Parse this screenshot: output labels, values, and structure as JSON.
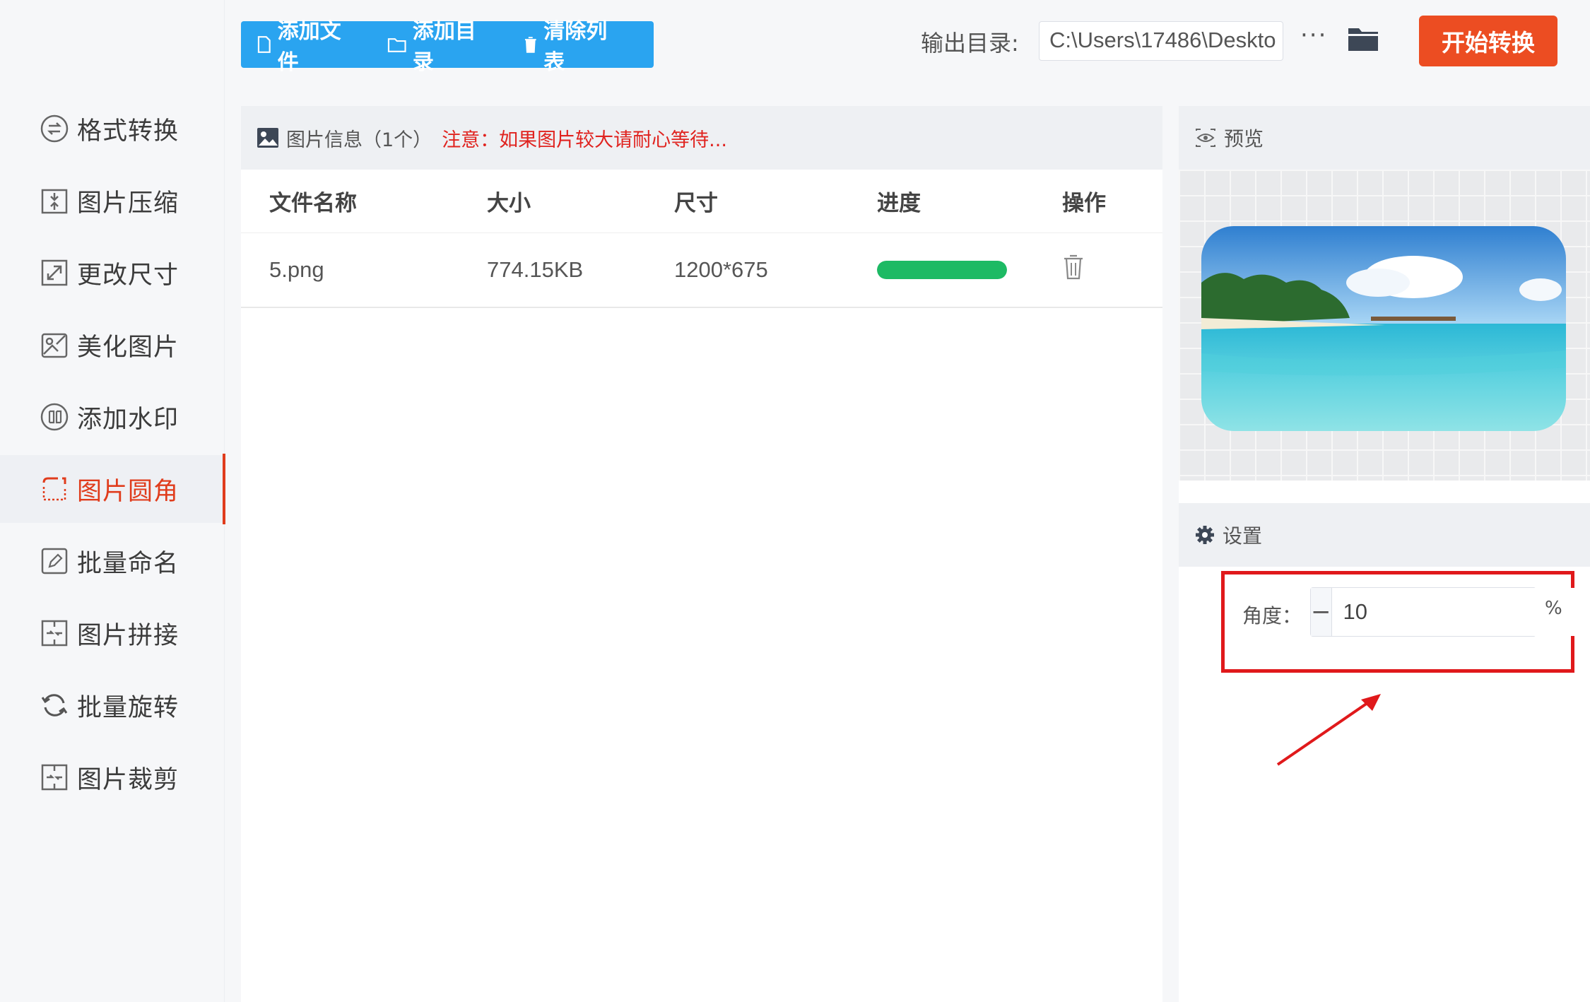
{
  "sidebar": {
    "items": [
      {
        "label": "格式转换",
        "icon": "format-convert-icon"
      },
      {
        "label": "图片压缩",
        "icon": "compress-icon"
      },
      {
        "label": "更改尺寸",
        "icon": "resize-icon"
      },
      {
        "label": "美化图片",
        "icon": "beautify-icon"
      },
      {
        "label": "添加水印",
        "icon": "watermark-icon"
      },
      {
        "label": "图片圆角",
        "icon": "rounded-corner-icon",
        "active": true
      },
      {
        "label": "批量命名",
        "icon": "rename-icon"
      },
      {
        "label": "图片拼接",
        "icon": "stitch-icon"
      },
      {
        "label": "批量旋转",
        "icon": "rotate-icon"
      },
      {
        "label": "图片裁剪",
        "icon": "crop-icon"
      }
    ]
  },
  "toolbar": {
    "add_file": "添加文件",
    "add_dir": "添加目录",
    "clear_list": "清除列表",
    "output_label": "输出目录:",
    "output_path": "C:\\Users\\17486\\Deskto",
    "more": "···",
    "start": "开始转换"
  },
  "info": {
    "title": "图片信息（1个）",
    "notice": "注意：如果图片较大请耐心等待..."
  },
  "table": {
    "headers": [
      "文件名称",
      "大小",
      "尺寸",
      "进度",
      "操作"
    ],
    "rows": [
      {
        "name": "5.png",
        "size": "774.15KB",
        "dimensions": "1200*675",
        "progress": 1.0
      }
    ]
  },
  "preview": {
    "title": "预览"
  },
  "settings": {
    "title": "设置",
    "angle_label": "角度：",
    "angle_value": "10",
    "minus": "−",
    "plus": "+",
    "unit": "%"
  },
  "colors": {
    "accent_red": "#e03c1c",
    "toolbar_blue": "#2aa4f0",
    "start_orange": "#ec4d22",
    "progress_green": "#1dba64",
    "highlight_red": "#e0191b"
  }
}
